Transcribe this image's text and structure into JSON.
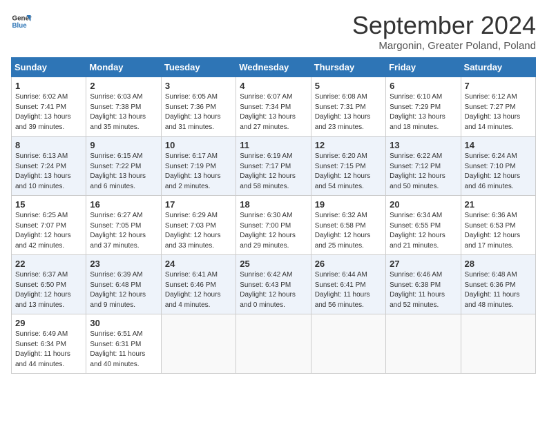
{
  "header": {
    "logo_line1": "General",
    "logo_line2": "Blue",
    "month_title": "September 2024",
    "subtitle": "Margonin, Greater Poland, Poland"
  },
  "weekdays": [
    "Sunday",
    "Monday",
    "Tuesday",
    "Wednesday",
    "Thursday",
    "Friday",
    "Saturday"
  ],
  "weeks": [
    [
      {
        "day": "1",
        "info": "Sunrise: 6:02 AM\nSunset: 7:41 PM\nDaylight: 13 hours\nand 39 minutes."
      },
      {
        "day": "2",
        "info": "Sunrise: 6:03 AM\nSunset: 7:38 PM\nDaylight: 13 hours\nand 35 minutes."
      },
      {
        "day": "3",
        "info": "Sunrise: 6:05 AM\nSunset: 7:36 PM\nDaylight: 13 hours\nand 31 minutes."
      },
      {
        "day": "4",
        "info": "Sunrise: 6:07 AM\nSunset: 7:34 PM\nDaylight: 13 hours\nand 27 minutes."
      },
      {
        "day": "5",
        "info": "Sunrise: 6:08 AM\nSunset: 7:31 PM\nDaylight: 13 hours\nand 23 minutes."
      },
      {
        "day": "6",
        "info": "Sunrise: 6:10 AM\nSunset: 7:29 PM\nDaylight: 13 hours\nand 18 minutes."
      },
      {
        "day": "7",
        "info": "Sunrise: 6:12 AM\nSunset: 7:27 PM\nDaylight: 13 hours\nand 14 minutes."
      }
    ],
    [
      {
        "day": "8",
        "info": "Sunrise: 6:13 AM\nSunset: 7:24 PM\nDaylight: 13 hours\nand 10 minutes."
      },
      {
        "day": "9",
        "info": "Sunrise: 6:15 AM\nSunset: 7:22 PM\nDaylight: 13 hours\nand 6 minutes."
      },
      {
        "day": "10",
        "info": "Sunrise: 6:17 AM\nSunset: 7:19 PM\nDaylight: 13 hours\nand 2 minutes."
      },
      {
        "day": "11",
        "info": "Sunrise: 6:19 AM\nSunset: 7:17 PM\nDaylight: 12 hours\nand 58 minutes."
      },
      {
        "day": "12",
        "info": "Sunrise: 6:20 AM\nSunset: 7:15 PM\nDaylight: 12 hours\nand 54 minutes."
      },
      {
        "day": "13",
        "info": "Sunrise: 6:22 AM\nSunset: 7:12 PM\nDaylight: 12 hours\nand 50 minutes."
      },
      {
        "day": "14",
        "info": "Sunrise: 6:24 AM\nSunset: 7:10 PM\nDaylight: 12 hours\nand 46 minutes."
      }
    ],
    [
      {
        "day": "15",
        "info": "Sunrise: 6:25 AM\nSunset: 7:07 PM\nDaylight: 12 hours\nand 42 minutes."
      },
      {
        "day": "16",
        "info": "Sunrise: 6:27 AM\nSunset: 7:05 PM\nDaylight: 12 hours\nand 37 minutes."
      },
      {
        "day": "17",
        "info": "Sunrise: 6:29 AM\nSunset: 7:03 PM\nDaylight: 12 hours\nand 33 minutes."
      },
      {
        "day": "18",
        "info": "Sunrise: 6:30 AM\nSunset: 7:00 PM\nDaylight: 12 hours\nand 29 minutes."
      },
      {
        "day": "19",
        "info": "Sunrise: 6:32 AM\nSunset: 6:58 PM\nDaylight: 12 hours\nand 25 minutes."
      },
      {
        "day": "20",
        "info": "Sunrise: 6:34 AM\nSunset: 6:55 PM\nDaylight: 12 hours\nand 21 minutes."
      },
      {
        "day": "21",
        "info": "Sunrise: 6:36 AM\nSunset: 6:53 PM\nDaylight: 12 hours\nand 17 minutes."
      }
    ],
    [
      {
        "day": "22",
        "info": "Sunrise: 6:37 AM\nSunset: 6:50 PM\nDaylight: 12 hours\nand 13 minutes."
      },
      {
        "day": "23",
        "info": "Sunrise: 6:39 AM\nSunset: 6:48 PM\nDaylight: 12 hours\nand 9 minutes."
      },
      {
        "day": "24",
        "info": "Sunrise: 6:41 AM\nSunset: 6:46 PM\nDaylight: 12 hours\nand 4 minutes."
      },
      {
        "day": "25",
        "info": "Sunrise: 6:42 AM\nSunset: 6:43 PM\nDaylight: 12 hours\nand 0 minutes."
      },
      {
        "day": "26",
        "info": "Sunrise: 6:44 AM\nSunset: 6:41 PM\nDaylight: 11 hours\nand 56 minutes."
      },
      {
        "day": "27",
        "info": "Sunrise: 6:46 AM\nSunset: 6:38 PM\nDaylight: 11 hours\nand 52 minutes."
      },
      {
        "day": "28",
        "info": "Sunrise: 6:48 AM\nSunset: 6:36 PM\nDaylight: 11 hours\nand 48 minutes."
      }
    ],
    [
      {
        "day": "29",
        "info": "Sunrise: 6:49 AM\nSunset: 6:34 PM\nDaylight: 11 hours\nand 44 minutes."
      },
      {
        "day": "30",
        "info": "Sunrise: 6:51 AM\nSunset: 6:31 PM\nDaylight: 11 hours\nand 40 minutes."
      },
      {
        "day": "",
        "info": ""
      },
      {
        "day": "",
        "info": ""
      },
      {
        "day": "",
        "info": ""
      },
      {
        "day": "",
        "info": ""
      },
      {
        "day": "",
        "info": ""
      }
    ]
  ]
}
